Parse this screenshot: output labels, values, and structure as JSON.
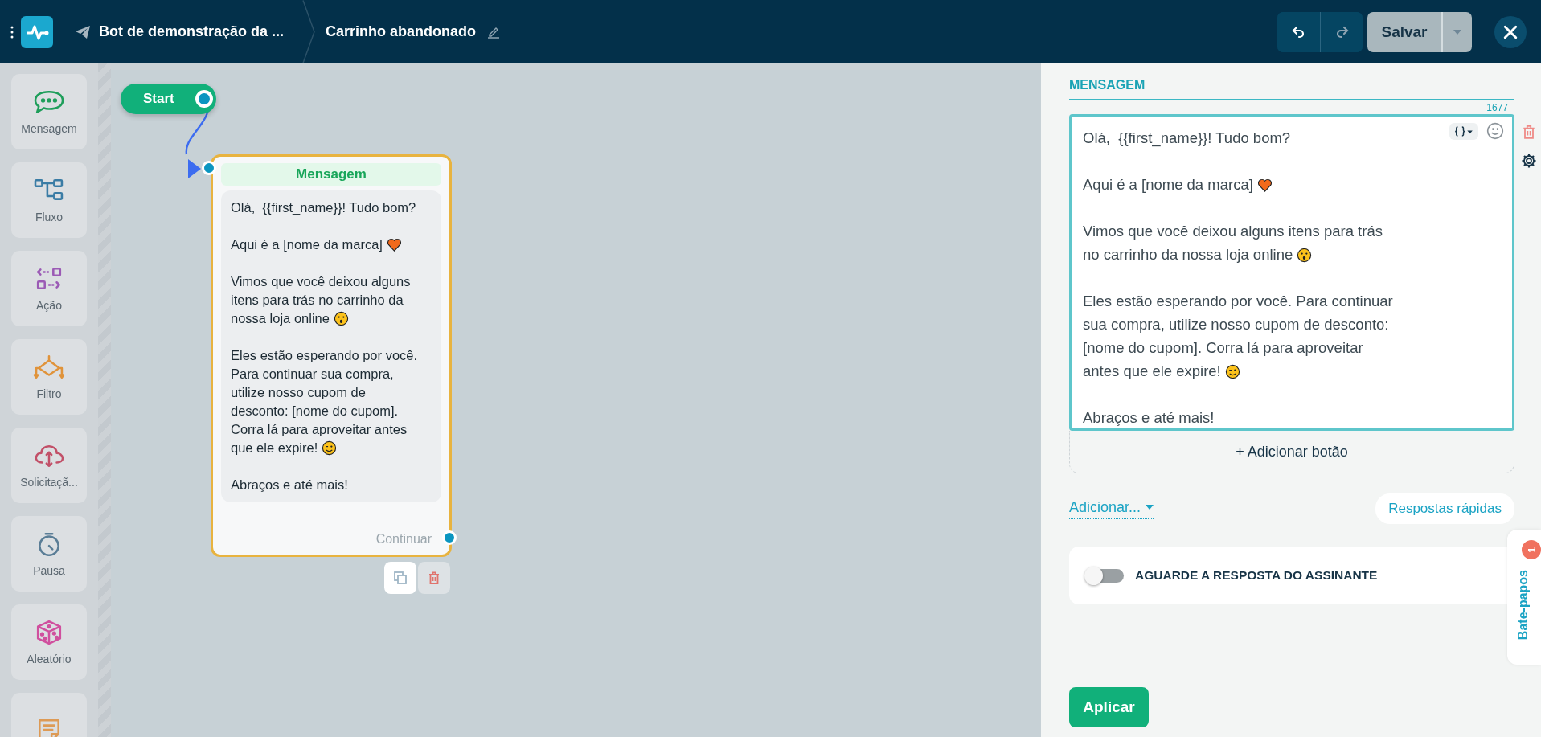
{
  "topbar": {
    "bot_name": "Bot de demonstração da ...",
    "flow_name": "Carrinho abandonado",
    "save_label": "Salvar"
  },
  "sidebar": {
    "items": [
      {
        "kind": "message",
        "label": "Mensagem"
      },
      {
        "kind": "flow",
        "label": "Fluxo"
      },
      {
        "kind": "action",
        "label": "Ação"
      },
      {
        "kind": "filter",
        "label": "Filtro"
      },
      {
        "kind": "request",
        "label": "Solicitaçã..."
      },
      {
        "kind": "pause",
        "label": "Pausa"
      },
      {
        "kind": "random",
        "label": "Aleatório"
      },
      {
        "kind": "note"
      }
    ]
  },
  "canvas": {
    "start_label": "Start",
    "node": {
      "title": "Mensagem",
      "continue_label": "Continuar",
      "paragraphs": [
        {
          "text": "Olá,  {{first_name}}! Tudo bom?"
        },
        {
          "text": "Aqui é a [nome da marca]",
          "emoji": {
            "kind": "heart"
          }
        },
        {
          "text": "Vimos que você deixou alguns itens para trás no carrinho da nossa loja online",
          "emoji": {
            "kind": "surprised"
          }
        },
        {
          "text": "Eles estão esperando por você. Para continuar sua compra, utilize nosso cupom de desconto: [nome do cupom]. Corra lá para aproveitar antes que ele expire!",
          "emoji": {
            "kind": "wink"
          }
        },
        {
          "text": "Abraços e até mais!"
        }
      ]
    }
  },
  "panel": {
    "tab": "MENSAGEM",
    "char_count": "1677",
    "paragraphs": [
      {
        "lines": [
          "Olá,  {{first_name}}! Tudo bom?"
        ]
      },
      {
        "lines": [
          "Aqui é a [nome da marca]"
        ],
        "emoji": {
          "kind": "heart"
        }
      },
      {
        "lines": [
          "Vimos que você deixou alguns itens para trás",
          "no carrinho da nossa loja online"
        ],
        "emoji": {
          "kind": "surprised"
        }
      },
      {
        "lines": [
          "Eles estão esperando por você. Para continuar",
          "sua compra, utilize nosso cupom de desconto:",
          "[nome do cupom]. Corra lá para aproveitar",
          "antes que ele expire!"
        ],
        "emoji": {
          "kind": "wink"
        }
      },
      {
        "lines": [
          "Abraços e até mais!"
        ]
      }
    ],
    "add_button": "+ Adicionar botão",
    "add_menu": "Adicionar...",
    "quick_replies": "Respostas rápidas",
    "wait_toggle": {
      "label": "AGUARDE A RESPOSTA DO ASSINANTE",
      "on": false
    },
    "apply": "Aplicar"
  },
  "chat_tab": {
    "label": "Bate-papos",
    "badge": "1"
  }
}
